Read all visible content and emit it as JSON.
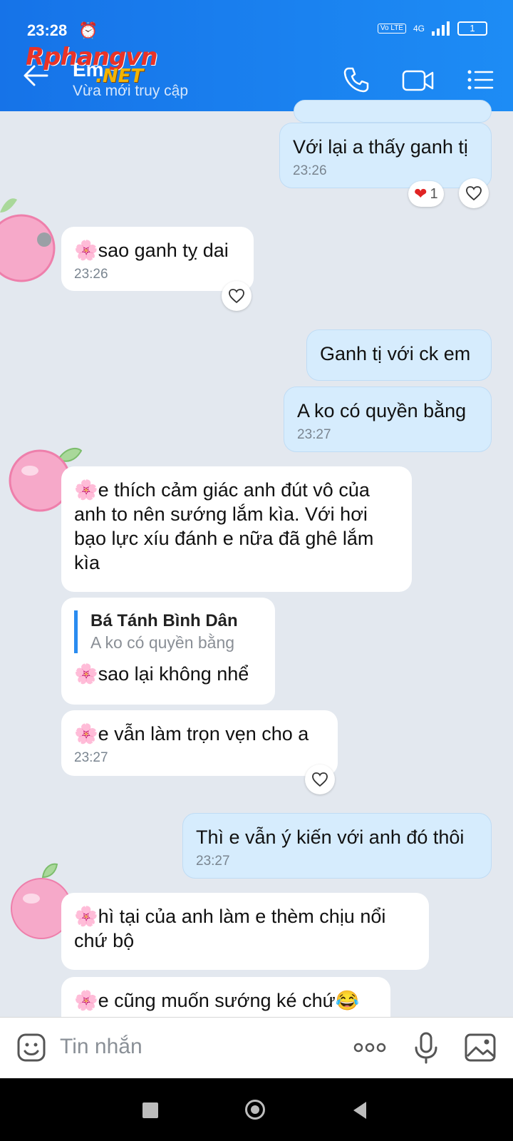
{
  "status": {
    "time": "23:28",
    "volte": "Vo LTE",
    "network": "4G",
    "battery": "1"
  },
  "header": {
    "title": "Em",
    "subtitle": "Vừa mới truy cập",
    "watermark": "Rphangvn",
    "watermark_suffix": ".NET"
  },
  "messages": [
    {
      "id": "m1",
      "dir": "out",
      "text": "Với lại a thấy ganh tị",
      "time": "23:26",
      "reaction_count": "1"
    },
    {
      "id": "m2",
      "dir": "in",
      "text": "sao ganh tỵ dai",
      "time": "23:26"
    },
    {
      "id": "m3",
      "dir": "out",
      "text": "Ganh tị với ck em"
    },
    {
      "id": "m4",
      "dir": "out",
      "text": "A ko có quyền bằng",
      "time": "23:27"
    },
    {
      "id": "m5",
      "dir": "in",
      "text": "e thích cảm giác anh đút vô của anh to nên sướng lắm kìa. Với hơi bạo lực xíu đánh e nữa đã ghê lắm kìa"
    },
    {
      "id": "m6",
      "dir": "in",
      "quote_name": "Bá Tánh Bình Dân",
      "quote_text": "A ko có quyền bằng",
      "text": "sao lại không nhể"
    },
    {
      "id": "m7",
      "dir": "in",
      "text": "e vẫn làm trọn vẹn cho a",
      "time": "23:27"
    },
    {
      "id": "m8",
      "dir": "out",
      "text": "Thì e vẫn ý kiến với anh đó thôi",
      "time": "23:27"
    },
    {
      "id": "m9",
      "dir": "in",
      "text": "hì tại của anh làm e thèm chịu nổi chứ bộ"
    },
    {
      "id": "m10",
      "dir": "in",
      "text": "e cũng muốn sướng ké chứ😂"
    }
  ],
  "input": {
    "placeholder": "Tin nhắn"
  },
  "colors": {
    "header": "#1d8cf5",
    "outgoing": "#d6ecfd",
    "incoming": "#ffffff",
    "background": "#e3e8ef"
  }
}
